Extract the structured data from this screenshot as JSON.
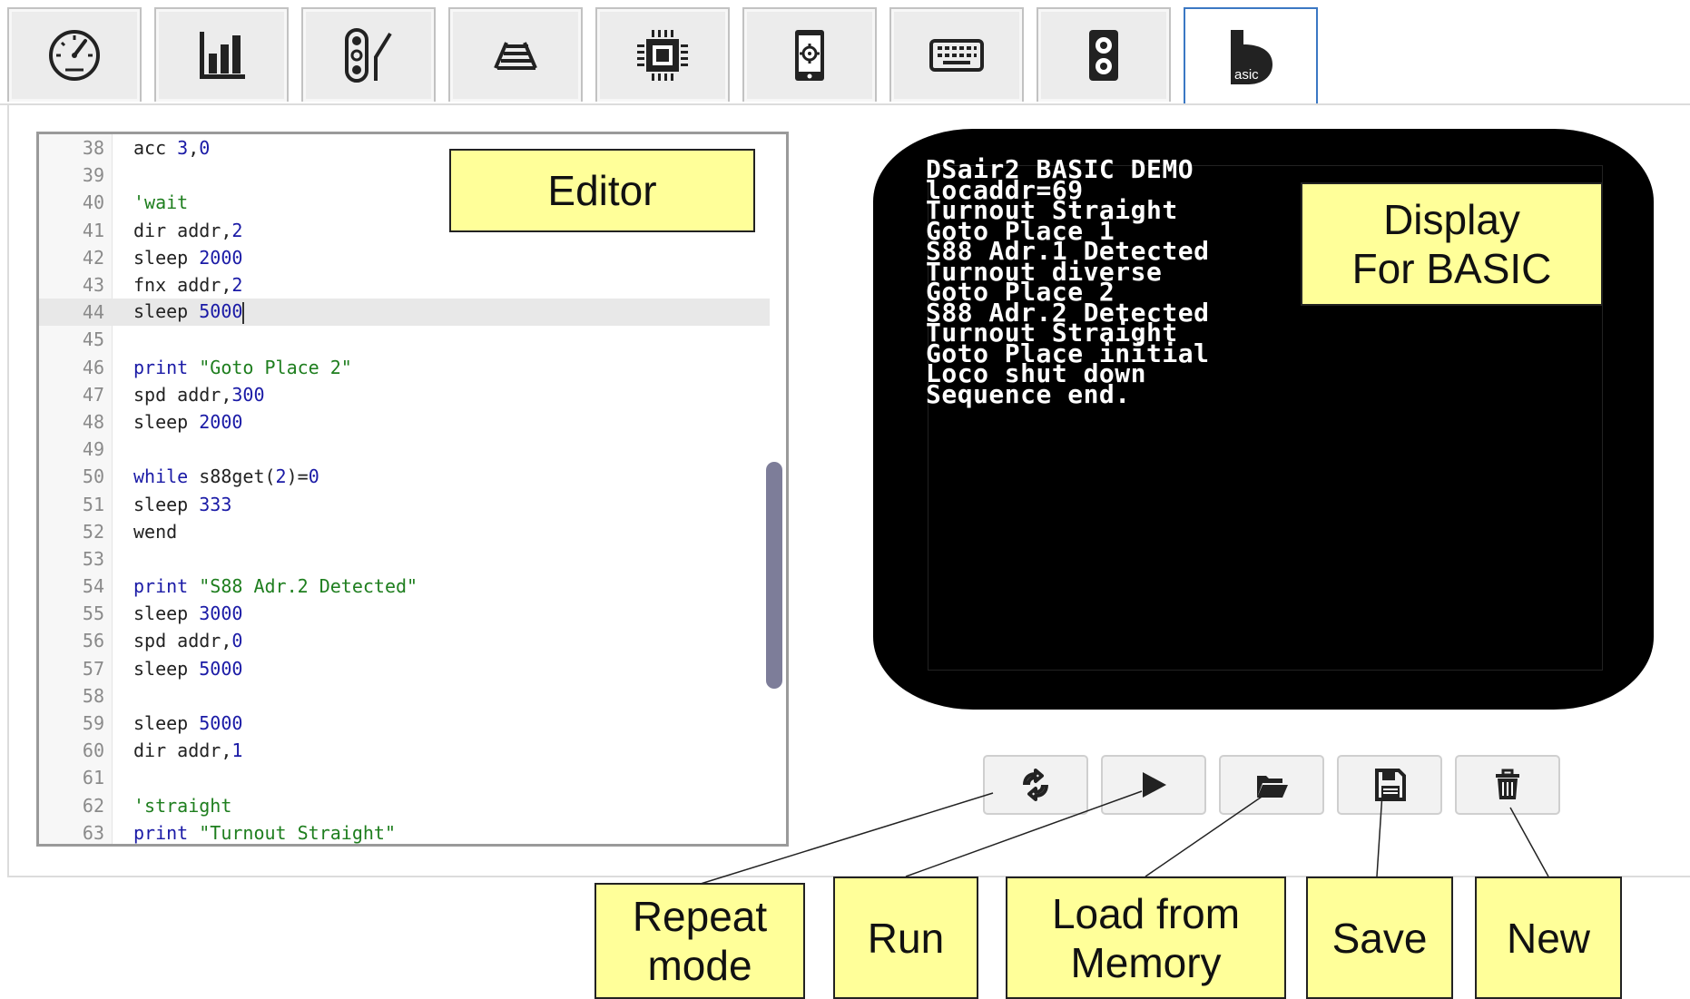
{
  "tabs": [
    {
      "icon": "speedometer-icon",
      "active": false
    },
    {
      "icon": "bar-chart-icon",
      "active": false
    },
    {
      "icon": "signal-turnout-icon",
      "active": false
    },
    {
      "icon": "track-icon",
      "active": false
    },
    {
      "icon": "chip-icon",
      "active": false
    },
    {
      "icon": "phone-settings-icon",
      "active": false
    },
    {
      "icon": "keyboard-icon",
      "active": false
    },
    {
      "icon": "speaker-icon",
      "active": false
    },
    {
      "icon": "basic-icon",
      "active": true,
      "label": "asic"
    }
  ],
  "editor": {
    "current_line": "44",
    "lines": [
      {
        "n": "38",
        "html": "acc <span class='num'>3</span>,<span class='num'>0</span>"
      },
      {
        "n": "39",
        "html": ""
      },
      {
        "n": "40",
        "html": "<span class='cmt'>'wait</span>"
      },
      {
        "n": "41",
        "html": "dir addr,<span class='num'>2</span>"
      },
      {
        "n": "42",
        "html": "sleep <span class='num'>2000</span>"
      },
      {
        "n": "43",
        "html": "fnx addr,<span class='num'>2</span>"
      },
      {
        "n": "44",
        "html": "sleep <span class='num'>5000</span><span class='cursor'></span>"
      },
      {
        "n": "45",
        "html": ""
      },
      {
        "n": "46",
        "html": "<span class='kw'>print</span> <span class='str'>\"Goto Place 2\"</span>"
      },
      {
        "n": "47",
        "html": "spd addr,<span class='num'>300</span>"
      },
      {
        "n": "48",
        "html": "sleep <span class='num'>2000</span>"
      },
      {
        "n": "49",
        "html": ""
      },
      {
        "n": "50",
        "html": "<span class='kw'>while</span> s88get(<span class='num'>2</span>)=<span class='num'>0</span>"
      },
      {
        "n": "51",
        "html": "sleep <span class='num'>333</span>"
      },
      {
        "n": "52",
        "html": "wend"
      },
      {
        "n": "53",
        "html": ""
      },
      {
        "n": "54",
        "html": "<span class='kw'>print</span> <span class='str'>\"S88 Adr.2 Detected\"</span>"
      },
      {
        "n": "55",
        "html": "sleep <span class='num'>3000</span>"
      },
      {
        "n": "56",
        "html": "spd addr,<span class='num'>0</span>"
      },
      {
        "n": "57",
        "html": "sleep <span class='num'>5000</span>"
      },
      {
        "n": "58",
        "html": ""
      },
      {
        "n": "59",
        "html": "sleep <span class='num'>5000</span>"
      },
      {
        "n": "60",
        "html": "dir addr,<span class='num'>1</span>"
      },
      {
        "n": "61",
        "html": ""
      },
      {
        "n": "62",
        "html": "<span class='cmt'>'straight</span>"
      },
      {
        "n": "63",
        "html": "<span class='kw'>print</span> <span class='str'>\"Turnout Straight\"</span>"
      }
    ]
  },
  "display": {
    "lines": [
      "DSair2 BASIC DEMO",
      "locaddr=69",
      "Turnout Straight",
      "Goto Place 1",
      "S88 Adr.1 Detected",
      "Turnout diverse",
      "Goto Place 2",
      "S88 Adr.2 Detected",
      "Turnout Straight",
      "Goto Place initial",
      "Loco shut down",
      "Sequence end."
    ]
  },
  "buttons": [
    {
      "name": "repeat-mode-button",
      "icon": "repeat-icon"
    },
    {
      "name": "run-button",
      "icon": "play-icon"
    },
    {
      "name": "load-button",
      "icon": "folder-open-icon"
    },
    {
      "name": "save-button",
      "icon": "floppy-disk-icon"
    },
    {
      "name": "new-button",
      "icon": "trash-icon"
    }
  ],
  "callouts": {
    "editor": "Editor",
    "display": "Display\nFor BASIC",
    "repeat": "Repeat\nmode",
    "run": "Run",
    "load": "Load from\nMemory",
    "save": "Save",
    "new": "New"
  },
  "colors": {
    "callout_bg": "#ffff99",
    "active_tab_border": "#3b78c4",
    "keyword": "#1a1aa6",
    "string": "#1e7e1e"
  }
}
